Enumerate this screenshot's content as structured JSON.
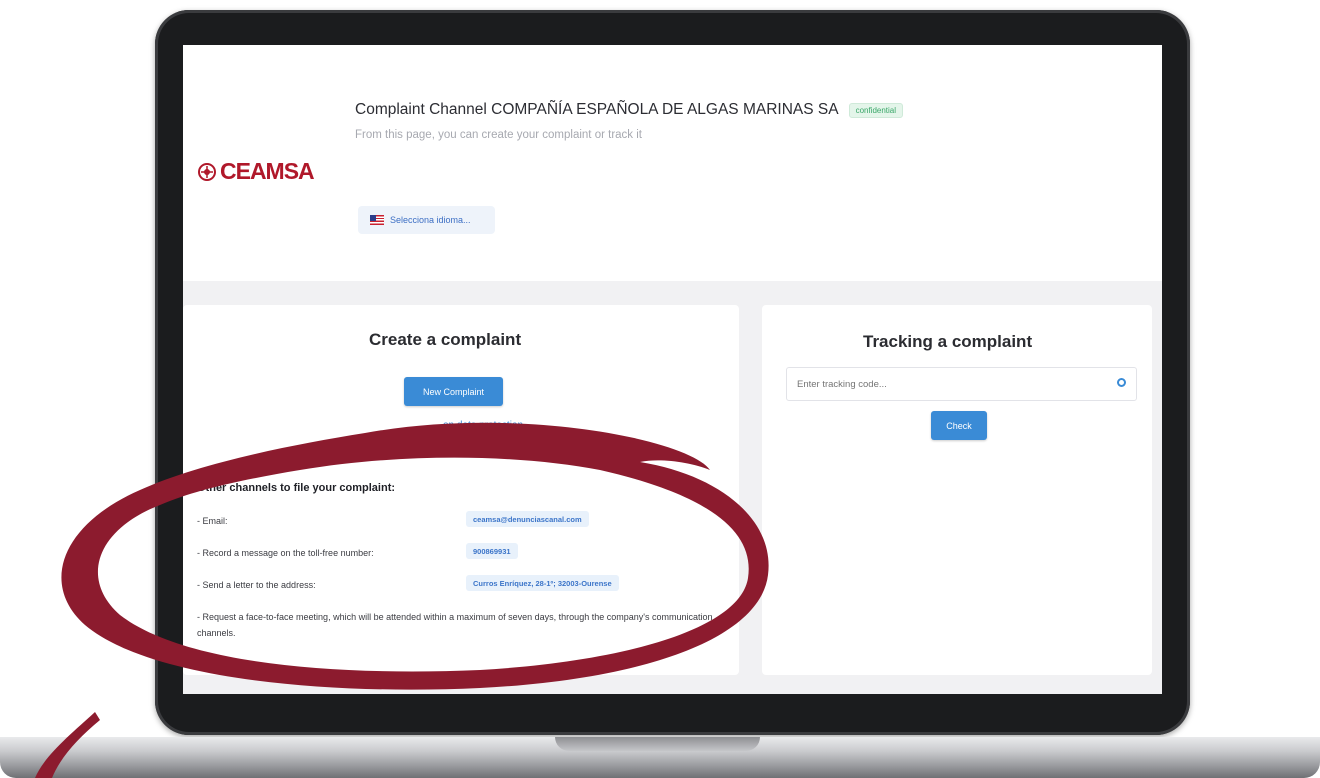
{
  "header": {
    "logo_text": "CEAMSA",
    "title": "Complaint Channel COMPAÑÍA ESPAÑOLA DE ALGAS MARINAS SA",
    "badge": "confidential",
    "subtitle": "From this page, you can create your complaint or track it",
    "language_button": "Selecciona idioma..."
  },
  "create_card": {
    "title": "Create a complaint",
    "new_complaint_button": "New Complaint",
    "data_protection_link": "on data protection",
    "other_channels_heading": "Other channels to file your complaint:",
    "channels": [
      {
        "label": "- Email:",
        "value": "ceamsa@denunciascanal.com"
      },
      {
        "label": "- Record a message on the toll-free number:",
        "value": "900869931"
      },
      {
        "label": "- Send a letter to the address:",
        "value": "Curros Enríquez, 28-1º; 32003-Ourense"
      }
    ],
    "meeting_text": "- Request a face-to-face meeting, which will be attended within a maximum of seven days, through the company's communication channels."
  },
  "track_card": {
    "title": "Tracking a complaint",
    "input_placeholder": "Enter tracking code...",
    "check_button": "Check"
  },
  "colors": {
    "accent": "#3a8bd6",
    "brand": "#b0182a",
    "annotation": "#8c1b2e"
  },
  "icons": {
    "logo": "ceamsa-logo-icon",
    "flag": "us-flag-icon",
    "search": "search-icon"
  }
}
